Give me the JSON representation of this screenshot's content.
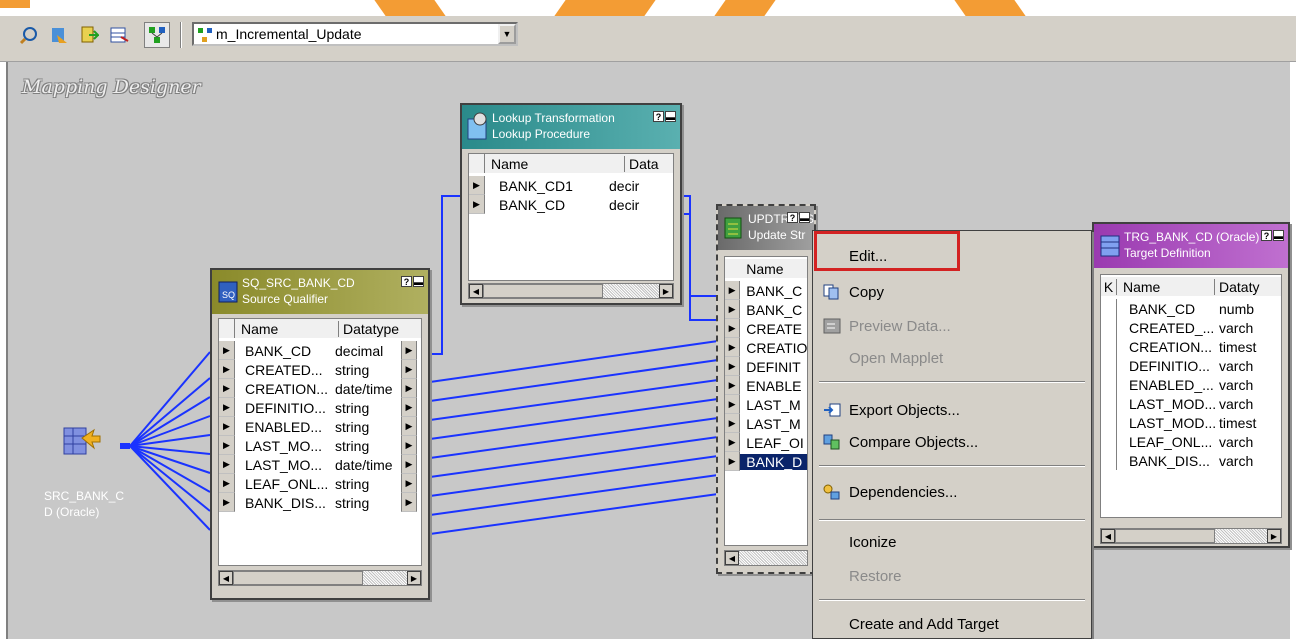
{
  "toolbar": {
    "buttons": [
      "source-analyzer-icon",
      "target-designer-icon",
      "transformation-developer-icon",
      "mapplet-designer-icon",
      "mapping-designer-icon"
    ],
    "mapping_select_value": "m_Incremental_Update"
  },
  "workspace": {
    "title": "Mapping Designer"
  },
  "source": {
    "label": "SRC_BANK_CD (Oracle)"
  },
  "lookup": {
    "title": "Lookup Transformation",
    "subtitle": "Lookup Procedure",
    "columns": [
      "Name",
      "Data"
    ],
    "rows": [
      {
        "name": "BANK_CD1",
        "type": "decir"
      },
      {
        "name": "BANK_CD",
        "type": "decir"
      }
    ]
  },
  "sq": {
    "title": "SQ_SRC_BANK_CD",
    "subtitle": "Source Qualifier",
    "columns": [
      "Name",
      "Datatype"
    ],
    "rows": [
      {
        "name": "BANK_CD",
        "type": "decimal"
      },
      {
        "name": "CREATED...",
        "type": "string"
      },
      {
        "name": "CREATION...",
        "type": "date/time"
      },
      {
        "name": "DEFINITIO...",
        "type": "string"
      },
      {
        "name": "ENABLED...",
        "type": "string"
      },
      {
        "name": "LAST_MO...",
        "type": "string"
      },
      {
        "name": "LAST_MO...",
        "type": "date/time"
      },
      {
        "name": "LEAF_ONL...",
        "type": "string"
      },
      {
        "name": "BANK_DIS...",
        "type": "string"
      }
    ]
  },
  "upd": {
    "title": "UPDTRANS",
    "subtitle": "Update Str",
    "columns": [
      "Name"
    ],
    "rows": [
      "BANK_C",
      "BANK_C",
      "CREATE",
      "CREATIO",
      "DEFINIT",
      "ENABLE",
      "LAST_M",
      "LAST_M",
      "LEAF_OI",
      "BANK_D"
    ]
  },
  "trg": {
    "title": "TRG_BANK_CD (Oracle)",
    "subtitle": "Target Definition",
    "columns": [
      "K",
      "Name",
      "Dataty"
    ],
    "rows": [
      {
        "name": "BANK_CD",
        "type": "numb"
      },
      {
        "name": "CREATED_...",
        "type": "varch"
      },
      {
        "name": "CREATION...",
        "type": "timest"
      },
      {
        "name": "DEFINITIO...",
        "type": "varch"
      },
      {
        "name": "ENABLED_...",
        "type": "varch"
      },
      {
        "name": "LAST_MOD...",
        "type": "varch"
      },
      {
        "name": "LAST_MOD...",
        "type": "timest"
      },
      {
        "name": "LEAF_ONL...",
        "type": "varch"
      },
      {
        "name": "BANK_DIS...",
        "type": "varch"
      }
    ]
  },
  "context_menu": {
    "edit": "Edit...",
    "copy": "Copy",
    "preview": "Preview Data...",
    "open_mapplet": "Open Mapplet",
    "export": "Export Objects...",
    "compare": "Compare Objects...",
    "dependencies": "Dependencies...",
    "iconize": "Iconize",
    "restore": "Restore",
    "create_target": "Create and Add Target"
  },
  "colors": {
    "highlight": "#d32222",
    "link": "#1a33ff",
    "lookup_header": "#2a8a8a",
    "sq_header": "#8a8a2a",
    "trg_header": "#9a3ab0"
  }
}
